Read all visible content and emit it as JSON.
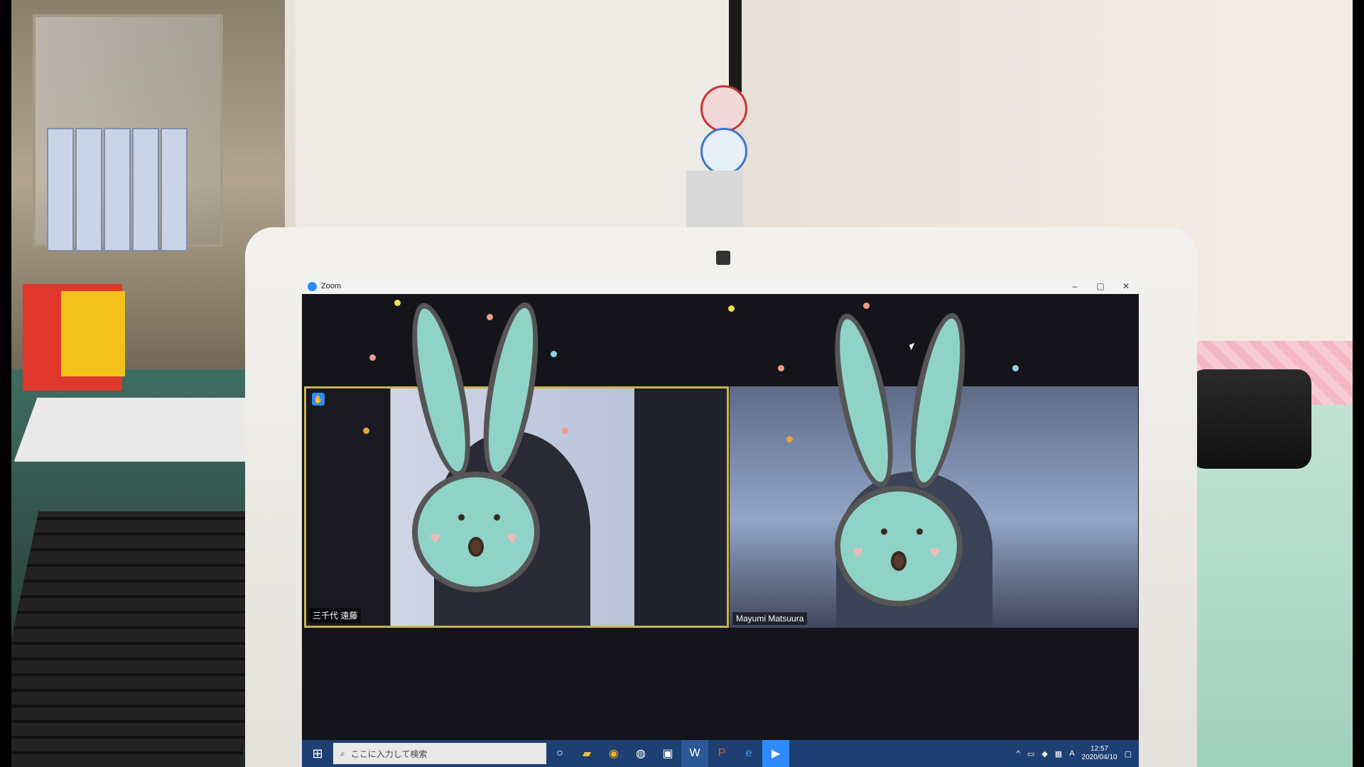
{
  "window": {
    "title": "Zoom",
    "minimize": "–",
    "maximize": "▢",
    "close": "✕"
  },
  "participants": [
    {
      "name": "三千代 遠藤"
    },
    {
      "name": "Mayumi Matsuura"
    }
  ],
  "taskbar": {
    "search_placeholder": "ここに入力して検索",
    "ime_indicator": "A",
    "clock_time": "12:57",
    "clock_date": "2020/04/10"
  },
  "colors": {
    "bunny": "#8fd3c7",
    "speaker_border": "#c9b24b",
    "taskbar": "#1e3f72",
    "zoom_blue": "#2d8cff"
  },
  "icons": {
    "start": "windows-logo-icon",
    "search": "search-icon",
    "cortana": "cortana-circle-icon",
    "explorer": "folder-icon",
    "chrome": "chrome-icon",
    "store": "store-icon",
    "word": "word-icon",
    "powerpoint": "powerpoint-icon",
    "edge": "edge-icon",
    "zoom": "zoom-icon"
  }
}
